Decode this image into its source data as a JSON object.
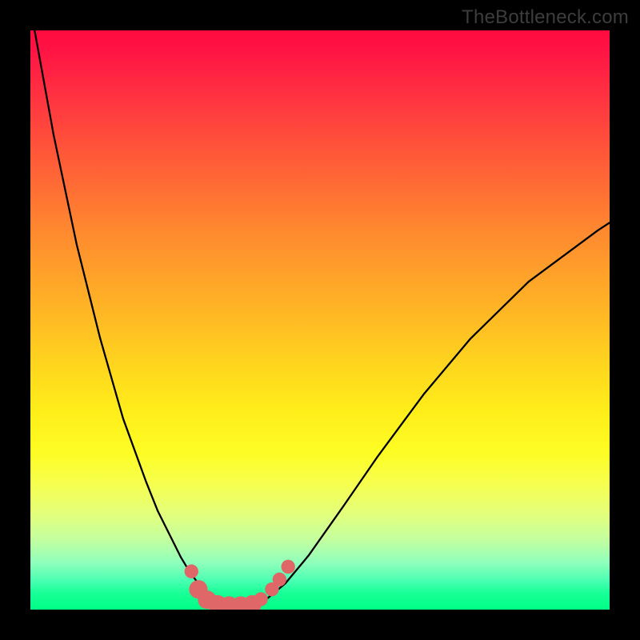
{
  "watermark": "TheBottleneck.com",
  "chart_data": {
    "type": "line",
    "title": "",
    "xlabel": "",
    "ylabel": "",
    "xlim": [
      0,
      100
    ],
    "ylim": [
      0,
      100
    ],
    "series": [
      {
        "name": "curve",
        "color": "#000000",
        "x": [
          0,
          4,
          8,
          12,
          16,
          20,
          22,
          24,
          26,
          27.5,
          29,
          31,
          33,
          35,
          36.6,
          38.5,
          41,
          44,
          48,
          54,
          60,
          68,
          76,
          86,
          98,
          100
        ],
        "y": [
          104,
          82,
          63,
          47,
          33,
          22,
          17,
          13,
          9,
          6.5,
          4.5,
          2.7,
          1.6,
          0.9,
          0.7,
          0.9,
          2.0,
          4.5,
          9.3,
          17.8,
          26.5,
          37.3,
          46.8,
          56.6,
          65.5,
          66.8
        ]
      }
    ],
    "markers": {
      "series": "curve",
      "color": "#e06767",
      "points": [
        {
          "x": 27.8,
          "y": 6.6,
          "r": 1.2
        },
        {
          "x": 29.0,
          "y": 3.5,
          "r": 1.6
        },
        {
          "x": 30.5,
          "y": 1.7,
          "r": 1.6
        },
        {
          "x": 32.3,
          "y": 0.9,
          "r": 1.6
        },
        {
          "x": 34.3,
          "y": 0.7,
          "r": 1.6
        },
        {
          "x": 36.3,
          "y": 0.7,
          "r": 1.6
        },
        {
          "x": 38.3,
          "y": 0.9,
          "r": 1.6
        },
        {
          "x": 39.8,
          "y": 1.8,
          "r": 1.2
        },
        {
          "x": 41.7,
          "y": 3.5,
          "r": 1.2
        },
        {
          "x": 43.0,
          "y": 5.2,
          "r": 1.2
        },
        {
          "x": 44.5,
          "y": 7.4,
          "r": 1.2
        }
      ]
    },
    "background_gradient": {
      "type": "vertical",
      "stops": [
        {
          "pos": 0.0,
          "color": "#ff0a3f"
        },
        {
          "pos": 0.35,
          "color": "#ff8a2f"
        },
        {
          "pos": 0.66,
          "color": "#ffee1a"
        },
        {
          "pos": 0.88,
          "color": "#c3ffa0"
        },
        {
          "pos": 1.0,
          "color": "#00ff86"
        }
      ]
    }
  }
}
